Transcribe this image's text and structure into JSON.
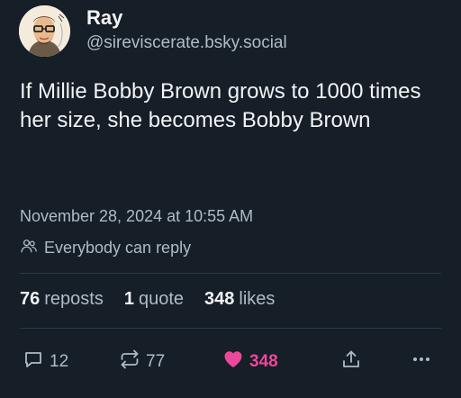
{
  "author": {
    "display_name": "Ray",
    "handle": "@sireviscerate.bsky.social"
  },
  "post": {
    "text": "If Millie Bobby Brown grows to 1000 times her size, she becomes Bobby Brown",
    "timestamp": "November 28, 2024 at 10:55 AM",
    "reply_setting": "Everybody can reply"
  },
  "stats": {
    "reposts_count": "76",
    "reposts_label": "reposts",
    "quotes_count": "1",
    "quotes_label": "quote",
    "likes_count": "348",
    "likes_label": "likes"
  },
  "actions": {
    "reply_count": "12",
    "repost_count": "77",
    "like_count": "348"
  },
  "icons": {
    "reply": "reply-icon",
    "repost": "repost-icon",
    "like": "heart-icon",
    "share": "share-icon",
    "more": "more-icon",
    "reply_setting": "people-icon"
  },
  "colors": {
    "background": "#161e27",
    "like_active": "#ec4899"
  }
}
